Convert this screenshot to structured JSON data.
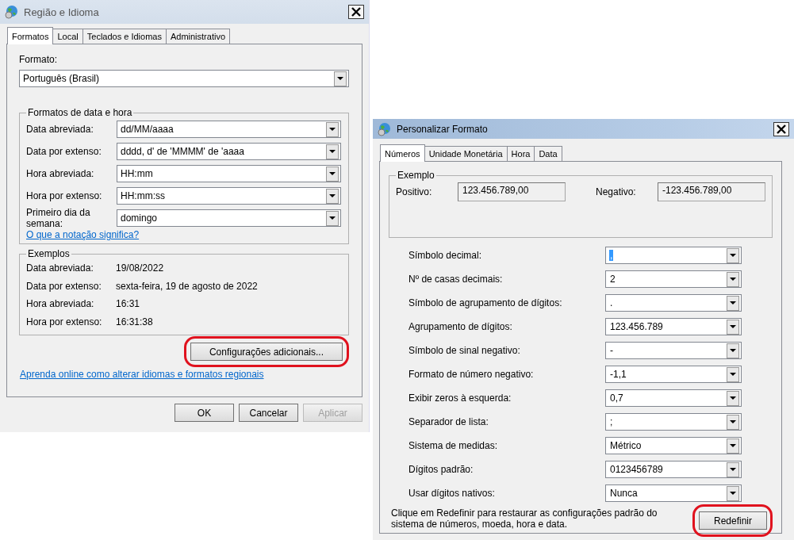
{
  "main_dialog": {
    "title": "Região e Idioma",
    "tabs": [
      {
        "label": "Formatos",
        "selected": true
      },
      {
        "label": "Local",
        "selected": false
      },
      {
        "label": "Teclados e Idiomas",
        "selected": false
      },
      {
        "label": "Administrativo",
        "selected": false
      }
    ],
    "format_label": "Formato:",
    "format_value": "Português (Brasil)",
    "datetime_group": {
      "title": "Formatos de data e hora",
      "rows": [
        {
          "label": "Data abreviada:",
          "value": "dd/MM/aaaa"
        },
        {
          "label": "Data por extenso:",
          "value": "dddd, d' de 'MMMM' de 'aaaa"
        },
        {
          "label": "Hora abreviada:",
          "value": "HH:mm"
        },
        {
          "label": "Hora por extenso:",
          "value": "HH:mm:ss"
        },
        {
          "label": "Primeiro dia da semana:",
          "value": "domingo"
        }
      ]
    },
    "notation_link": "O que a notação significa?",
    "examples_group": {
      "title": "Exemplos",
      "rows": [
        {
          "label": "Data abreviada:",
          "value": "19/08/2022"
        },
        {
          "label": "Data por extenso:",
          "value": "sexta-feira, 19 de agosto de 2022"
        },
        {
          "label": "Hora abreviada:",
          "value": "16:31"
        },
        {
          "label": "Hora por extenso:",
          "value": "16:31:38"
        }
      ]
    },
    "additional_button": {
      "label": "Configurações adicionais...",
      "highlighted": true
    },
    "online_link": "Aprenda online como alterar idiomas e formatos regionais",
    "buttons": [
      {
        "label": "OK",
        "disabled": false
      },
      {
        "label": "Cancelar",
        "disabled": false
      },
      {
        "label": "Aplicar",
        "disabled": true
      }
    ]
  },
  "custom_dialog": {
    "title": "Personalizar Formato",
    "tabs": [
      {
        "label": "Números",
        "selected": true
      },
      {
        "label": "Unidade Monetária",
        "selected": false
      },
      {
        "label": "Hora",
        "selected": false
      },
      {
        "label": "Data",
        "selected": false
      }
    ],
    "example_group": {
      "title": "Exemplo",
      "positive_label": "Positivo:",
      "positive_value": "123.456.789,00",
      "negative_label": "Negativo:",
      "negative_value": "-123.456.789,00"
    },
    "settings": [
      {
        "label": "Símbolo decimal:",
        "value": ",",
        "text_selected": true
      },
      {
        "label": "Nº de casas decimais:",
        "value": "2",
        "text_selected": false
      },
      {
        "label": "Símbolo de agrupamento de dígitos:",
        "value": ".",
        "text_selected": false
      },
      {
        "label": "Agrupamento de dígitos:",
        "value": "123.456.789",
        "text_selected": false
      },
      {
        "label": "Símbolo de sinal negativo:",
        "value": "-",
        "text_selected": false
      },
      {
        "label": "Formato de número negativo:",
        "value": "-1,1",
        "text_selected": false
      },
      {
        "label": "Exibir zeros à esquerda:",
        "value": "0,7",
        "text_selected": false
      },
      {
        "label": "Separador de lista:",
        "value": ";",
        "text_selected": false
      },
      {
        "label": "Sistema de medidas:",
        "value": "Métrico",
        "text_selected": false
      },
      {
        "label": "Dígitos padrão:",
        "value": "0123456789",
        "text_selected": false
      },
      {
        "label": "Usar dígitos nativos:",
        "value": "Nunca",
        "text_selected": false
      }
    ],
    "reset_note": "Clique em Redefinir para restaurar as configurações padrão do sistema de números, moeda, hora e data.",
    "reset_button": {
      "label": "Redefinir",
      "highlighted": true
    }
  }
}
